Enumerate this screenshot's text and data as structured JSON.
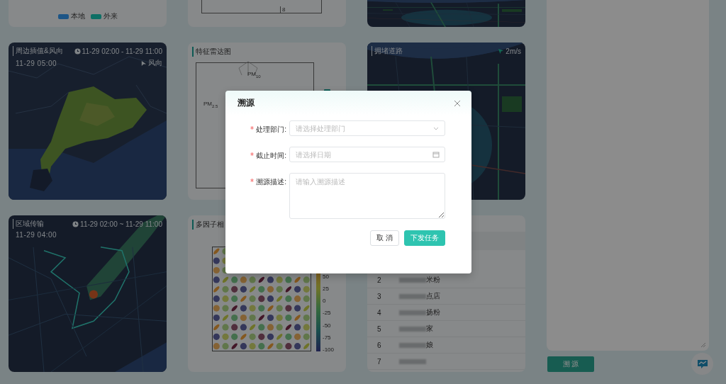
{
  "legend_card": {
    "items": [
      {
        "label": "本地",
        "color": "#1d5586"
      },
      {
        "label": "外来",
        "color": "#0f6f66"
      }
    ]
  },
  "radar_fragment": {
    "axis_label": "8"
  },
  "interpolation_map": {
    "title": "周边插值&风向",
    "time_range": "11-29 02:00 - 11-29 11:00",
    "timestamp": "11-29 05:00",
    "wind_label": "风向"
  },
  "radar_card": {
    "title": "特征雷达图",
    "labels": [
      "PM$_{10}$",
      "PM$_{2.5}$"
    ]
  },
  "congestion_map": {
    "title": "拥堵道路",
    "wind_speed": "2m/s"
  },
  "transport_map": {
    "title": "区域传输",
    "time_range": "11-29 02:00 ~ 11-29 11:00",
    "timestamp": "11-29 04:00"
  },
  "correlation_card": {
    "title": "多因子相",
    "colorbar_ticks": [
      "50",
      "25",
      "0",
      "-25",
      "-50",
      "-75",
      "-100"
    ]
  },
  "ranking_table": {
    "rows": [
      {
        "index": "2",
        "name_suffix": "米粉"
      },
      {
        "index": "3",
        "name_suffix": "点店"
      },
      {
        "index": "4",
        "name_suffix": "扬粉"
      },
      {
        "index": "5",
        "name_suffix": "家"
      },
      {
        "index": "6",
        "name_suffix": "娘"
      },
      {
        "index": "7"
      }
    ]
  },
  "trace_button": "溯 源",
  "dialog": {
    "title": "溯源",
    "fields": [
      {
        "kind": "select",
        "label": "处理部门:",
        "required": true,
        "placeholder": "请选择处理部门"
      },
      {
        "kind": "date",
        "label": "截止时间:",
        "required": true,
        "placeholder": "请选择日期"
      },
      {
        "kind": "textarea",
        "label": "溯源描述:",
        "required": true,
        "placeholder": "请输入溯源描述"
      }
    ],
    "buttons": [
      {
        "label": "取 消",
        "kind": "default"
      },
      {
        "label": "下发任务",
        "kind": "primary"
      }
    ]
  }
}
